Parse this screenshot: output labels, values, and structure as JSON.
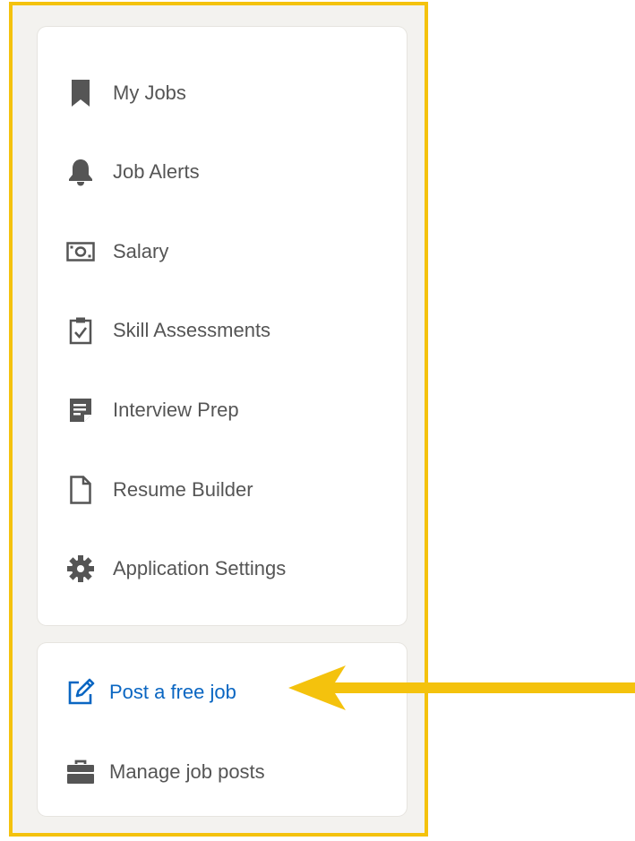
{
  "menu": {
    "items": [
      {
        "label": "My Jobs",
        "icon": "bookmark-icon"
      },
      {
        "label": "Job Alerts",
        "icon": "bell-icon"
      },
      {
        "label": "Salary",
        "icon": "money-icon"
      },
      {
        "label": "Skill Assessments",
        "icon": "clipboard-check-icon"
      },
      {
        "label": "Interview Prep",
        "icon": "note-icon"
      },
      {
        "label": "Resume Builder",
        "icon": "document-icon"
      },
      {
        "label": "Application Settings",
        "icon": "gear-icon"
      }
    ]
  },
  "job_posting": {
    "items": [
      {
        "label": "Post a free job",
        "icon": "edit-icon"
      },
      {
        "label": "Manage job posts",
        "icon": "briefcase-icon"
      }
    ]
  },
  "colors": {
    "highlight_border": "#f4c20d",
    "arrow": "#f4c20d",
    "accent_link": "#0a66c2",
    "icon_gray": "#555555",
    "panel_background": "#f3f2ef"
  },
  "annotation": {
    "arrow_icon": "arrow-left-icon",
    "points_to": "Post a free job"
  }
}
